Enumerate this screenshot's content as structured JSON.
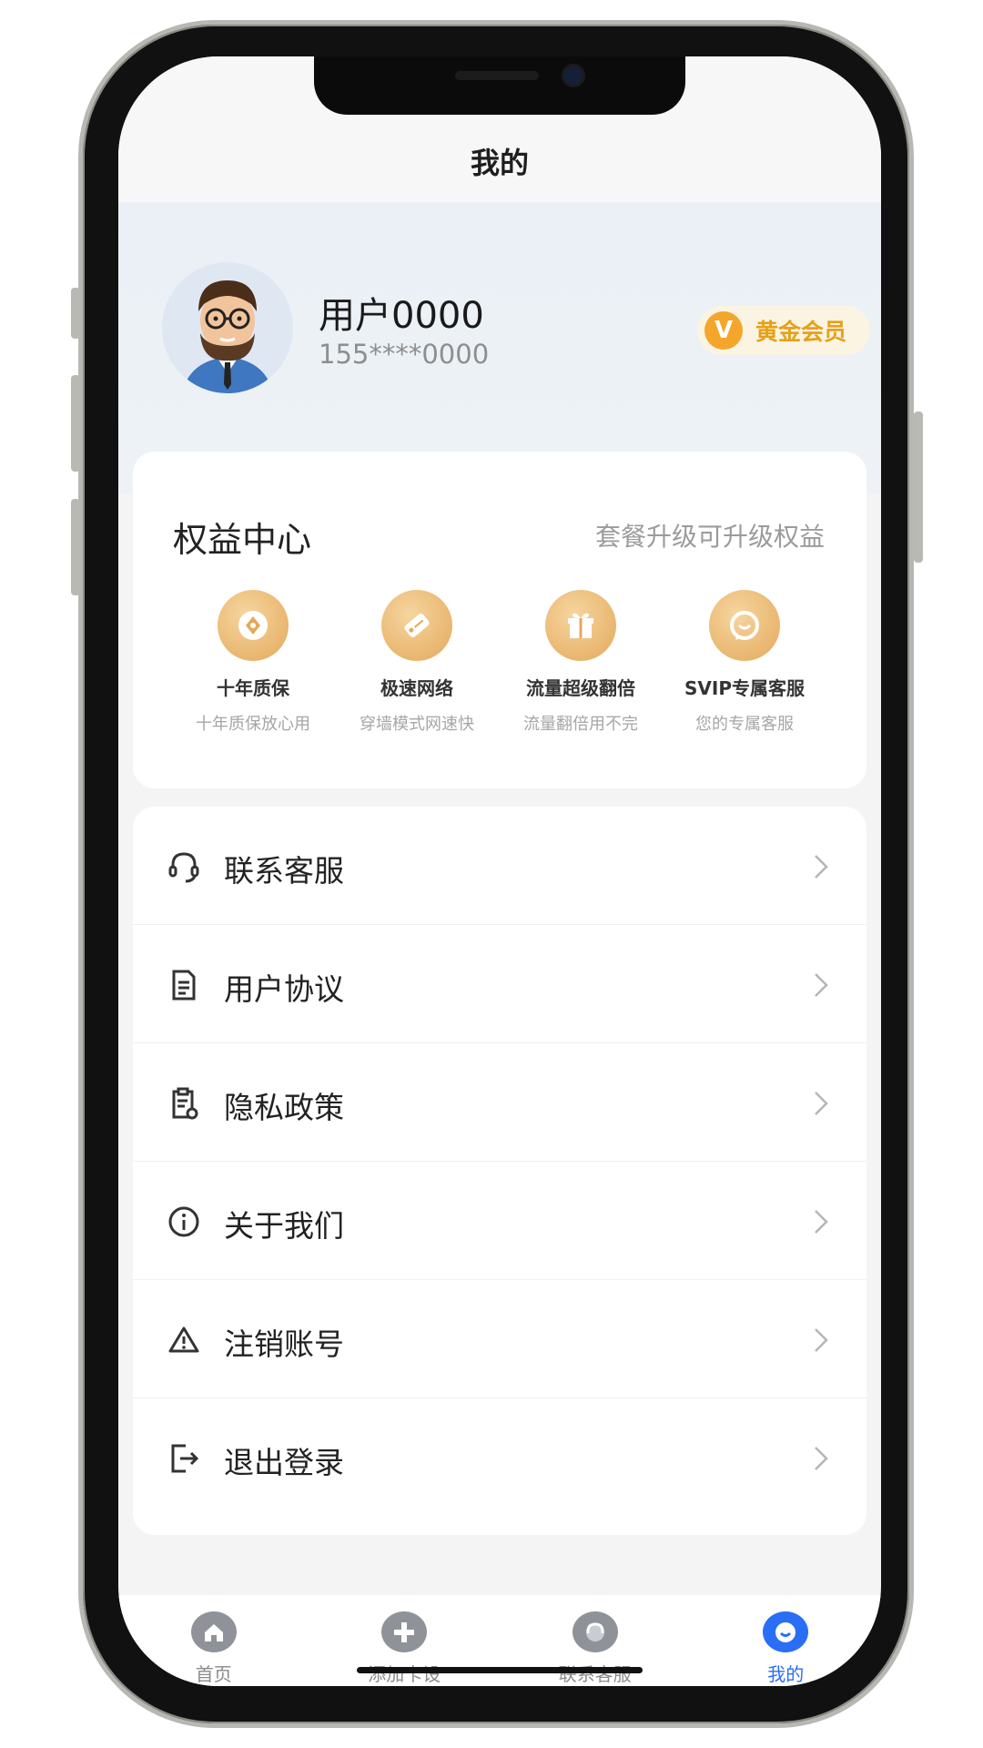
{
  "header": {
    "title": "我的"
  },
  "profile": {
    "name": "用户0000",
    "phone": "155****0000",
    "vip_letter": "V",
    "vip_label": "黄金会员"
  },
  "rights": {
    "title": "权益中心",
    "subtitle": "套餐升级可升级权益",
    "items": [
      {
        "label": "十年质保",
        "desc": "十年质保放心用",
        "icon": "coin-icon"
      },
      {
        "label": "极速网络",
        "desc": "穿墙模式网速快",
        "icon": "tag-icon"
      },
      {
        "label": "流量超级翻倍",
        "desc": "流量翻倍用不完",
        "icon": "gift-icon"
      },
      {
        "label": "SVIP专属客服",
        "desc": "您的专属客服",
        "icon": "service-icon"
      }
    ]
  },
  "menu": {
    "items": [
      {
        "label": "联系客服",
        "icon": "headset-icon"
      },
      {
        "label": "用户协议",
        "icon": "document-icon"
      },
      {
        "label": "隐私政策",
        "icon": "privacy-doc-icon"
      },
      {
        "label": "关于我们",
        "icon": "info-icon"
      },
      {
        "label": "注销账号",
        "icon": "warning-icon"
      },
      {
        "label": "退出登录",
        "icon": "logout-icon"
      }
    ]
  },
  "tabbar": {
    "items": [
      {
        "label": "首页",
        "icon": "home-icon"
      },
      {
        "label": "添加卡设",
        "icon": "add-icon"
      },
      {
        "label": "联系客服",
        "icon": "headset-icon"
      },
      {
        "label": "我的",
        "icon": "profile-icon"
      }
    ],
    "active": "我的"
  },
  "colors": {
    "accent_blue": "#2a6ef5",
    "gold": "#e6a117",
    "rights_icon": "#e3a95b"
  }
}
